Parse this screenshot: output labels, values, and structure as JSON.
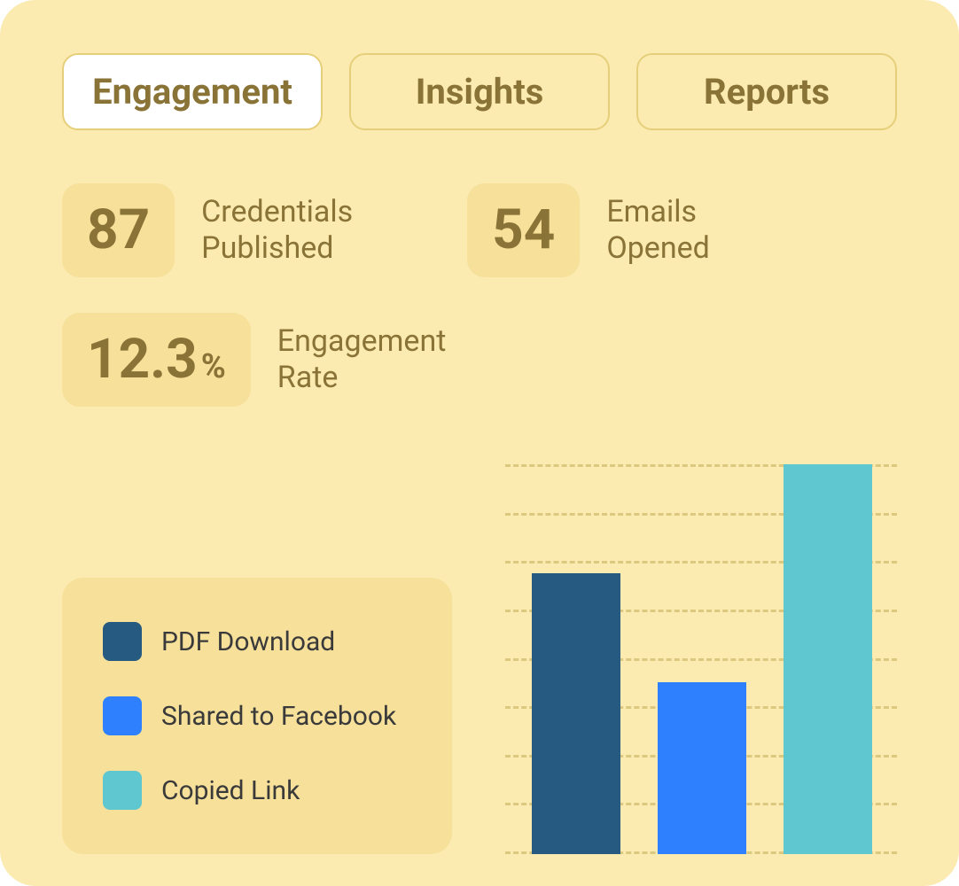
{
  "tabs": [
    {
      "label": "Engagement",
      "active": true
    },
    {
      "label": "Insights",
      "active": false
    },
    {
      "label": "Reports",
      "active": false
    }
  ],
  "stats": [
    {
      "value": "87",
      "label": "Credentials Published"
    },
    {
      "value": "54",
      "label": "Emails Opened"
    },
    {
      "value": "12.3",
      "suffix": "%",
      "label": "Engagement Rate"
    }
  ],
  "legend": [
    {
      "label": "PDF Download",
      "color": "#265a80"
    },
    {
      "label": "Shared to Facebook",
      "color": "#2f80ff"
    },
    {
      "label": "Copied Link",
      "color": "#5fc7cf"
    }
  ],
  "chart_data": {
    "type": "bar",
    "categories": [
      "PDF Download",
      "Shared to Facebook",
      "Copied Link"
    ],
    "series": [
      {
        "name": "PDF Download",
        "value": 72,
        "color": "#265a80"
      },
      {
        "name": "Shared to Facebook",
        "value": 44,
        "color": "#2f80ff"
      },
      {
        "name": "Copied Link",
        "value": 100,
        "color": "#5fc7cf"
      }
    ],
    "ylim": [
      0,
      100
    ],
    "gridlines": 9,
    "title": "",
    "xlabel": "",
    "ylabel": ""
  }
}
